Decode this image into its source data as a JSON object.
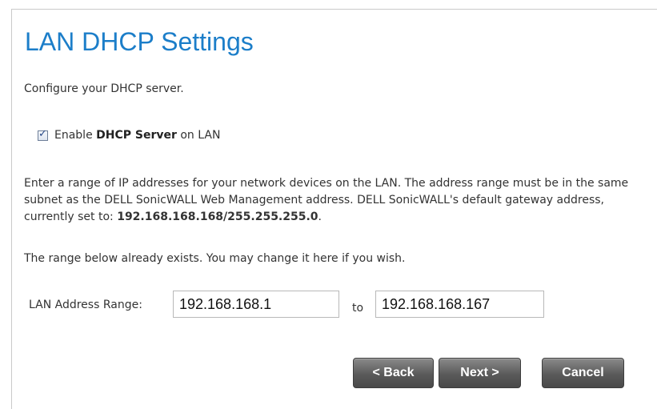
{
  "page": {
    "title": "LAN DHCP Settings",
    "intro": "Configure your DHCP server."
  },
  "dhcp": {
    "enabled": true,
    "label_prefix": "Enable ",
    "label_bold": "DHCP Server",
    "label_suffix": " on LAN"
  },
  "description": {
    "text": "Enter a range of IP addresses for your network devices on the LAN. The address range must be in the same subnet as the DELL SonicWALL Web Management address. DELL SonicWALL's default gateway address, currently set to: ",
    "gateway": "192.168.168.168/255.255.255.0",
    "end": "."
  },
  "range_note": "The range below already exists. You may change it here if you wish.",
  "range": {
    "label": "LAN Address Range:",
    "from": "192.168.168.1",
    "to_label": "to",
    "to": "192.168.168.167"
  },
  "buttons": {
    "back": "< Back",
    "next": "Next >",
    "cancel": "Cancel"
  }
}
